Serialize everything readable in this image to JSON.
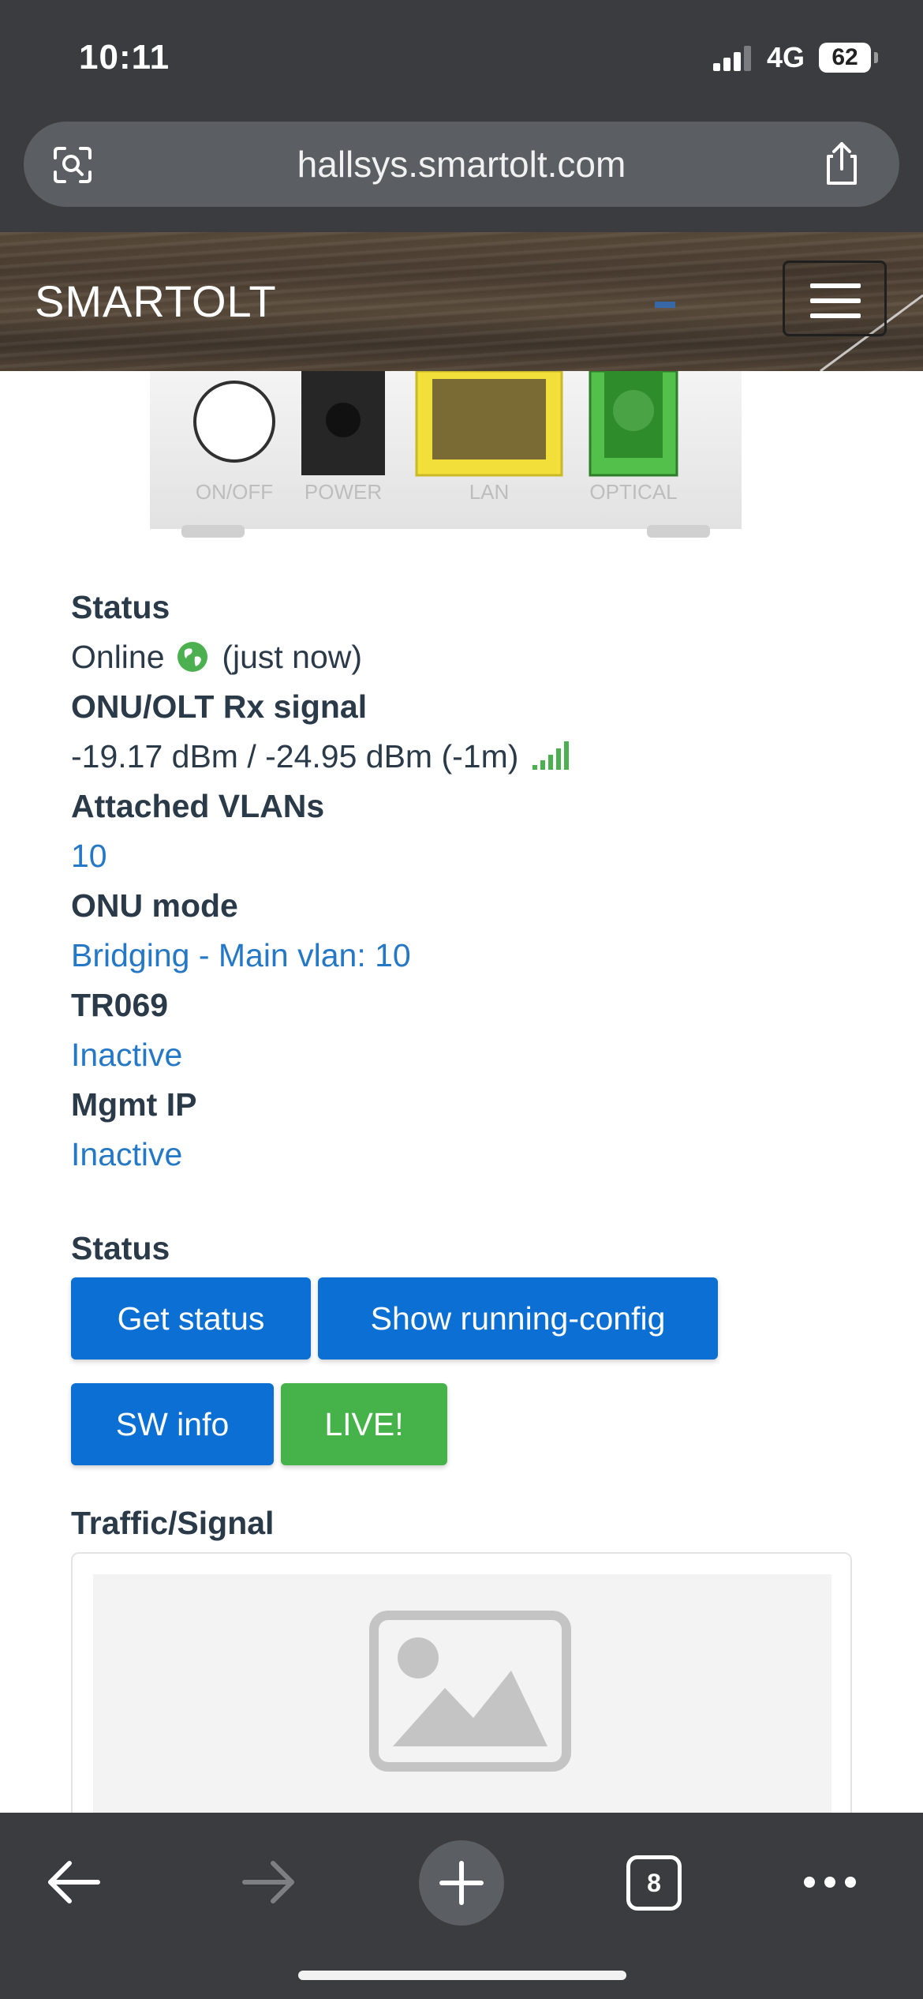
{
  "status_bar": {
    "time": "10:11",
    "network": "4G",
    "battery": "62"
  },
  "browser": {
    "url": "hallsys.smartolt.com",
    "tab_count": "8"
  },
  "header": {
    "brand": "SMARTOLT"
  },
  "device": {
    "port_labels": [
      "ON/OFF",
      "POWER",
      "LAN",
      "OPTICAL"
    ]
  },
  "info": {
    "status_label": "Status",
    "status_value": "Online",
    "status_time": "(just now)",
    "signal_label": "ONU/OLT Rx signal",
    "signal_value": "-19.17 dBm / -24.95 dBm (-1m)",
    "vlans_label": "Attached VLANs",
    "vlans_value": "10",
    "mode_label": "ONU mode",
    "mode_value": "Bridging - Main vlan: 10",
    "tr069_label": "TR069",
    "tr069_value": "Inactive",
    "mgmt_label": "Mgmt IP",
    "mgmt_value": "Inactive"
  },
  "actions": {
    "title": "Status",
    "get_status": "Get status",
    "show_config": "Show running-config",
    "sw_info": "SW info",
    "live": "LIVE!"
  },
  "traffic": {
    "title": "Traffic/Signal"
  },
  "colors": {
    "link": "#2478c6",
    "primary": "#0b6fd3",
    "success": "#46b24a",
    "chrome": "#3a3c3f"
  }
}
